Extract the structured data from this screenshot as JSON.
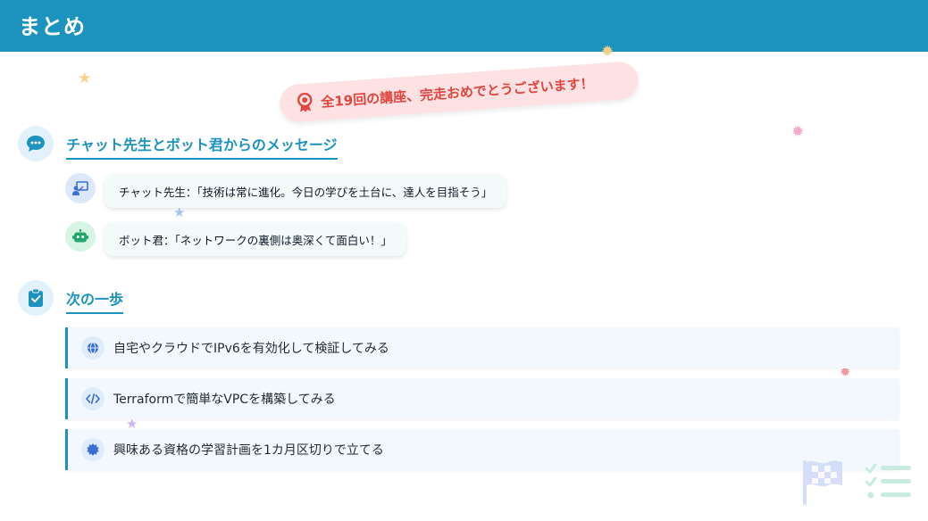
{
  "header": {
    "title": "まとめ"
  },
  "celebration": {
    "text": "全19回の講座、完走おめでとうございます！"
  },
  "messages_section": {
    "title": "チャット先生とボット君からのメッセージ",
    "messages": [
      {
        "speaker_icon": "teacher-icon",
        "text": "チャット先生：「技術は常に進化。今日の学びを土台に、達人を目指そう」"
      },
      {
        "speaker_icon": "robot-icon",
        "text": "ボット君：「ネットワークの裏側は奥深くて面白い！」"
      }
    ]
  },
  "next_steps_section": {
    "title": "次の一歩",
    "steps": [
      {
        "icon": "globe-icon",
        "text": "自宅やクラウドでIPv6を有効化して検証してみる"
      },
      {
        "icon": "code-icon",
        "text": "Terraformで簡単なVPCを構築してみる"
      },
      {
        "icon": "badge-icon",
        "text": "興味ある資格の学習計画を1カ月区切りで立てる"
      }
    ]
  },
  "colors": {
    "header": "#1c93be",
    "accent": "#1c93be",
    "ribbon_bg": "#fde1e3",
    "ribbon_text": "#e1463f"
  }
}
